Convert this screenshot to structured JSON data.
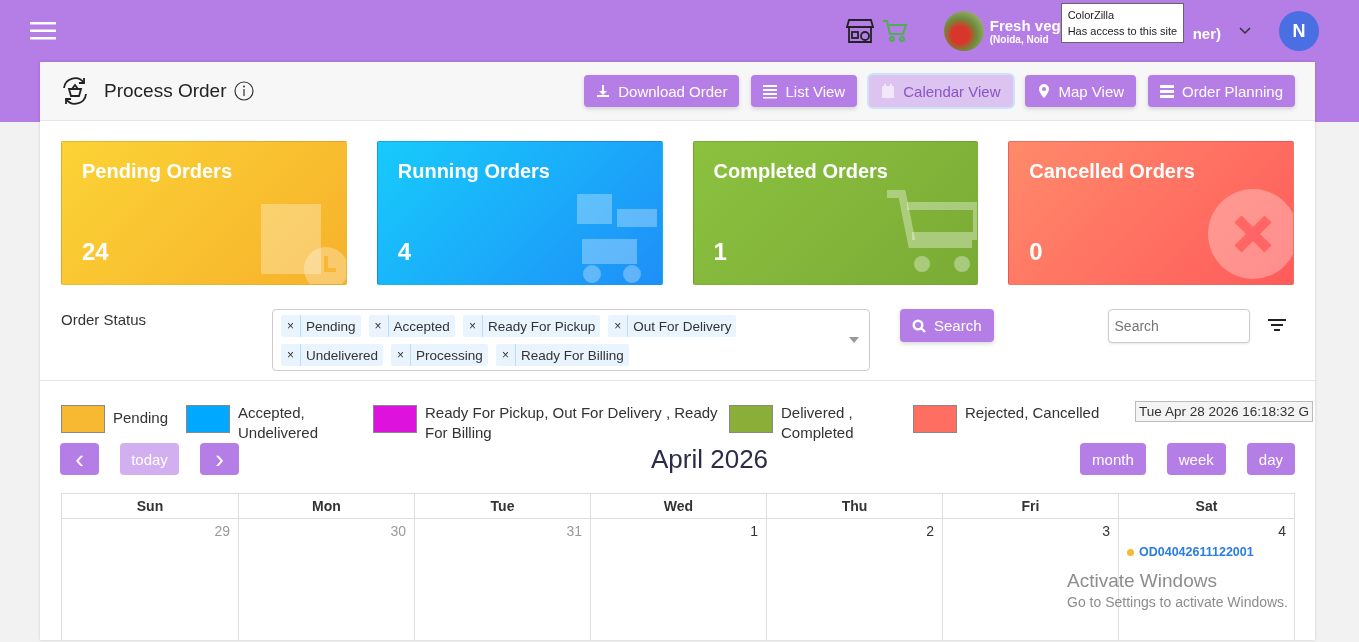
{
  "topbar": {
    "store_name": "Fresh veg",
    "store_name_tail": "ner)",
    "store_location": "(Noida, Noid",
    "avatar_letter": "N"
  },
  "tooltip": {
    "title": "ColorZilla",
    "text": "Has access to this site"
  },
  "header": {
    "title": "Process Order"
  },
  "view_buttons": [
    {
      "label": "Download Order",
      "kind": "download",
      "selected": false
    },
    {
      "label": "List View",
      "kind": "list",
      "selected": false
    },
    {
      "label": "Calendar View",
      "kind": "calendar",
      "selected": true
    },
    {
      "label": "Map View",
      "kind": "map",
      "selected": false
    },
    {
      "label": "Order Planning",
      "kind": "planning",
      "selected": false
    }
  ],
  "stats": [
    {
      "label": "Pending Orders",
      "count": "24",
      "kind": "pending"
    },
    {
      "label": "Running Orders",
      "count": "4",
      "kind": "running"
    },
    {
      "label": "Completed Orders",
      "count": "1",
      "kind": "completed"
    },
    {
      "label": "Cancelled Orders",
      "count": "0",
      "kind": "cancelled"
    }
  ],
  "filters": {
    "label": "Order Status",
    "remove_glyph": "×",
    "tags": [
      "Pending",
      "Accepted",
      "Ready For Pickup",
      "Out For Delivery",
      "Undelivered",
      "Processing",
      "Ready For Billing"
    ],
    "search_button": "Search",
    "search_placeholder": "Search"
  },
  "legend": [
    {
      "label": "Pending",
      "color": "#f8b932"
    },
    {
      "label": "Accepted, Undelivered",
      "color": "#00a9ff"
    },
    {
      "label": "Ready For Pickup, Out For Delivery , Ready For Billing",
      "color": "#dd12dd"
    },
    {
      "label": "Delivered , Completed",
      "color": "#8bae38"
    },
    {
      "label": "Rejected, Cancelled",
      "color": "#ff6f61"
    }
  ],
  "datetime": "Tue Apr 28 2026 16:18:32 G",
  "calendar": {
    "prev_glyph": "‹",
    "next_glyph": "›",
    "today": {
      "label": "today",
      "disabled": true
    },
    "title": "April 2026",
    "views": [
      {
        "label": "month",
        "selected": false
      },
      {
        "label": "week",
        "selected": false
      },
      {
        "label": "day",
        "selected": false
      }
    ],
    "weekdays": [
      "Sun",
      "Mon",
      "Tue",
      "Wed",
      "Thu",
      "Fri",
      "Sat"
    ],
    "days": [
      {
        "date": "29",
        "other_month": true
      },
      {
        "date": "30",
        "other_month": true
      },
      {
        "date": "31",
        "other_month": true
      },
      {
        "date": "1",
        "other_month": false
      },
      {
        "date": "2",
        "other_month": false
      },
      {
        "date": "3",
        "other_month": false
      },
      {
        "date": "4",
        "other_month": false,
        "events": [
          {
            "label": "OD04042611122001",
            "color": "#f8b932"
          }
        ]
      }
    ]
  },
  "os_watermark": {
    "title": "Activate Windows",
    "text": "Go to Settings to activate Windows."
  }
}
